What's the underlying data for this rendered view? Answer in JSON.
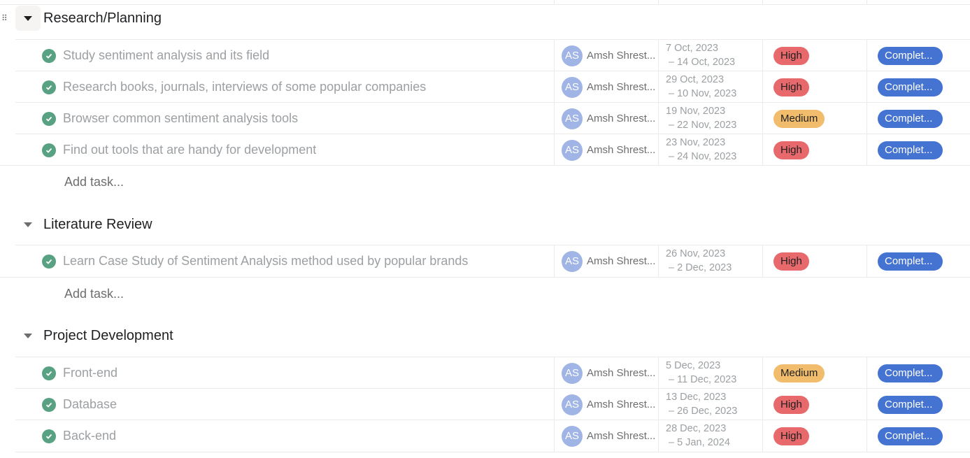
{
  "assignee": {
    "initials": "AS",
    "name": "Amsh Shrestha"
  },
  "add_task_label": "Add task...",
  "priority_colors": {
    "High": "#e8696b",
    "Medium": "#f1bd6c"
  },
  "status_color": "#4573d2",
  "sections": [
    {
      "title": "Research/Planning",
      "tasks": [
        {
          "name": "Study sentiment analysis  and its field",
          "start": "7 Oct, 2023",
          "end": "– 14 Oct, 2023",
          "priority": "High",
          "status": "Complet..."
        },
        {
          "name": "Research books, journals, interviews of some popular companies",
          "start": "29 Oct, 2023",
          "end": "– 10 Nov, 2023",
          "priority": "High",
          "status": "Complet..."
        },
        {
          "name": "Browser common sentiment analysis tools",
          "start": "19 Nov, 2023",
          "end": "– 22 Nov, 2023",
          "priority": "Medium",
          "status": "Complet..."
        },
        {
          "name": "Find out tools that are handy for development",
          "start": "23 Nov, 2023",
          "end": "– 24 Nov, 2023",
          "priority": "High",
          "status": "Complet..."
        }
      ]
    },
    {
      "title": "Literature Review",
      "tasks": [
        {
          "name": "Learn Case Study of Sentiment Analysis method used by popular brands",
          "start": "26 Nov, 2023",
          "end": "– 2 Dec, 2023",
          "priority": "High",
          "status": "Complet..."
        }
      ]
    },
    {
      "title": "Project Development",
      "tasks": [
        {
          "name": "Front-end",
          "start": "5 Dec, 2023",
          "end": "– 11 Dec, 2023",
          "priority": "Medium",
          "status": "Complet..."
        },
        {
          "name": "Database",
          "start": "13 Dec, 2023",
          "end": "– 26 Dec, 2023",
          "priority": "High",
          "status": "Complet..."
        },
        {
          "name": "Back-end",
          "start": "28 Dec, 2023",
          "end": "– 5 Jan, 2024",
          "priority": "High",
          "status": "Complet..."
        }
      ]
    }
  ]
}
